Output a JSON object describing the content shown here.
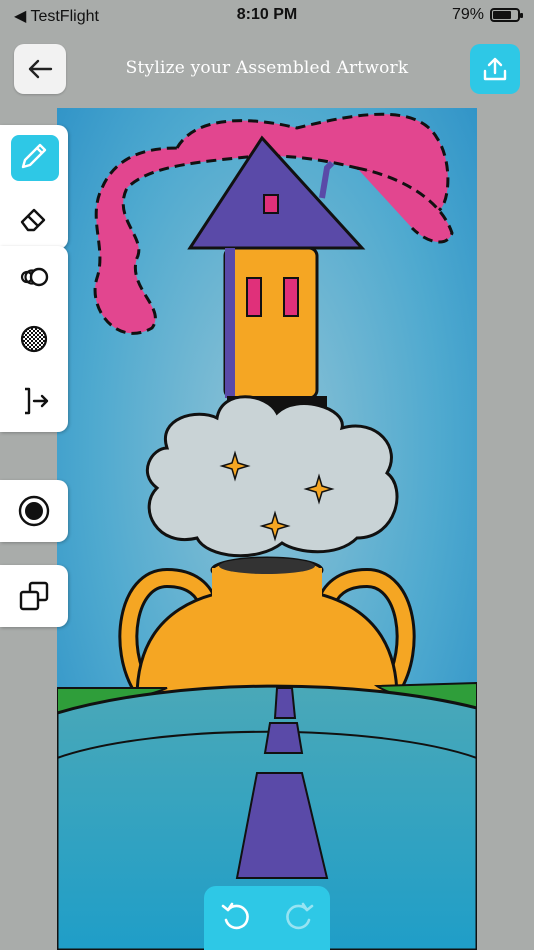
{
  "status_bar": {
    "carrier": "◀ TestFlight",
    "time": "8:10 PM",
    "battery": "79%"
  },
  "header": {
    "title": "Stylize your Assembled Artwork",
    "back_icon": "arrow-left-icon",
    "share_icon": "share-upload-icon"
  },
  "toolbar": {
    "groups": [
      {
        "tools": [
          {
            "icon": "pencil-icon",
            "active": true
          },
          {
            "icon": "eraser-icon",
            "active": false
          }
        ]
      },
      {
        "tools": [
          {
            "icon": "blend-circles-icon"
          },
          {
            "icon": "texture-circle-icon"
          },
          {
            "icon": "export-bracket-arrow-icon"
          }
        ]
      },
      {
        "tools": [
          {
            "icon": "brush-size-dot-icon"
          }
        ]
      },
      {
        "tools": [
          {
            "icon": "layers-squares-icon"
          }
        ]
      }
    ]
  },
  "bottom_controls": {
    "undo_icon": "undo-icon",
    "redo_icon": "redo-icon"
  },
  "colors": {
    "accent": "#2ec8e6",
    "background": "#a9acaa"
  }
}
